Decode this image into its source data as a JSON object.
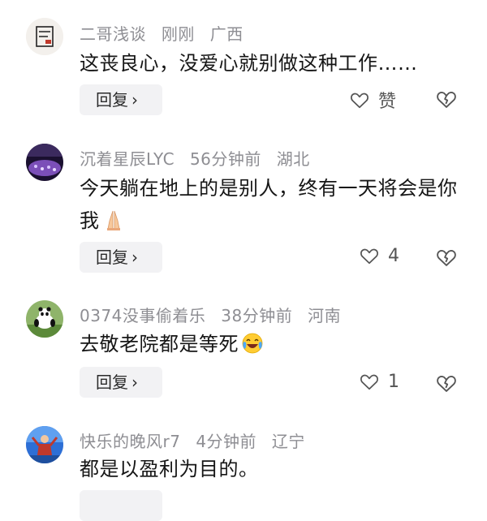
{
  "comments": [
    {
      "username": "二哥浅谈",
      "time": "刚刚",
      "location": "广西",
      "text": "这丧良心，没爱心就别做这种工作……",
      "reply_label": "回复",
      "like_label": "赞"
    },
    {
      "username": "沉着星辰LYC",
      "time": "56分钟前",
      "location": "湖北",
      "text": "今天躺在地上的是别人，终有一天将会是你我",
      "emoji": "praying-hands",
      "reply_label": "回复",
      "like_count": "4"
    },
    {
      "username": "0374没事偷着乐",
      "time": "38分钟前",
      "location": "河南",
      "text": "去敬老院都是等死",
      "emoji": "crying-laughing",
      "reply_label": "回复",
      "like_count": "1"
    },
    {
      "username": "快乐的晚风r7",
      "time": "4分钟前",
      "location": "辽宁",
      "text": "都是以盈利为目的。"
    }
  ],
  "icons": {
    "like": "heart-outline-icon",
    "dislike": "broken-heart-icon",
    "reply_chevron": "chevron-right-icon"
  },
  "colors": {
    "meta_text": "#8e8e93",
    "body_text": "#161616",
    "reply_bg": "#f2f2f4"
  }
}
